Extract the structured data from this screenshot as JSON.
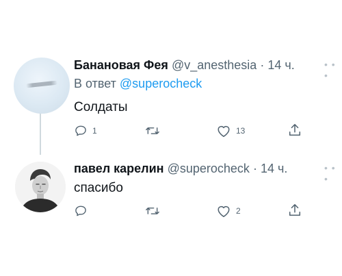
{
  "tweets": [
    {
      "author_name": "Банановая Фея",
      "handle": "@v_anesthesia",
      "separator": "·",
      "time": "14 ч.",
      "reply_prefix": "В ответ",
      "reply_to": "@superocheck",
      "text": "Солдаты",
      "actions": {
        "replies": "1",
        "retweets": "",
        "likes": "13",
        "share": ""
      }
    },
    {
      "author_name": "павел карелин",
      "handle": "@superocheck",
      "separator": "·",
      "time": "14 ч.",
      "text": "спасибо",
      "actions": {
        "replies": "",
        "retweets": "",
        "likes": "2",
        "share": ""
      }
    }
  ],
  "colors": {
    "link": "#1d9bf0",
    "secondary_text": "#536471",
    "primary_text": "#0f1419",
    "thread_line": "#cfd9de"
  },
  "icons": [
    "reply-icon",
    "retweet-icon",
    "like-icon",
    "share-icon",
    "more-icon"
  ]
}
